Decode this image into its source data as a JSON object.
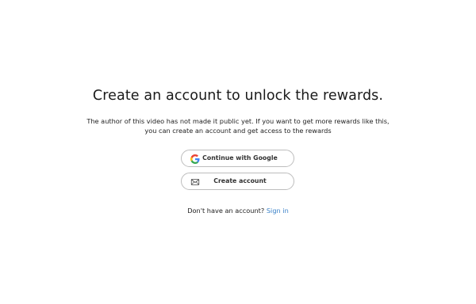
{
  "heading": "Create an account to unlock the rewards.",
  "description": {
    "line1": "The author of this video has not made it public yet. If you want to get more rewards like this,",
    "line2": "you can create an account and get access to the rewards"
  },
  "buttons": {
    "google": {
      "label": "Continue with Google",
      "icon": "google-icon"
    },
    "create": {
      "label": "Create account",
      "icon": "envelope-icon"
    }
  },
  "footer": {
    "prompt": "Don't have an account?",
    "link": "Sign in"
  }
}
